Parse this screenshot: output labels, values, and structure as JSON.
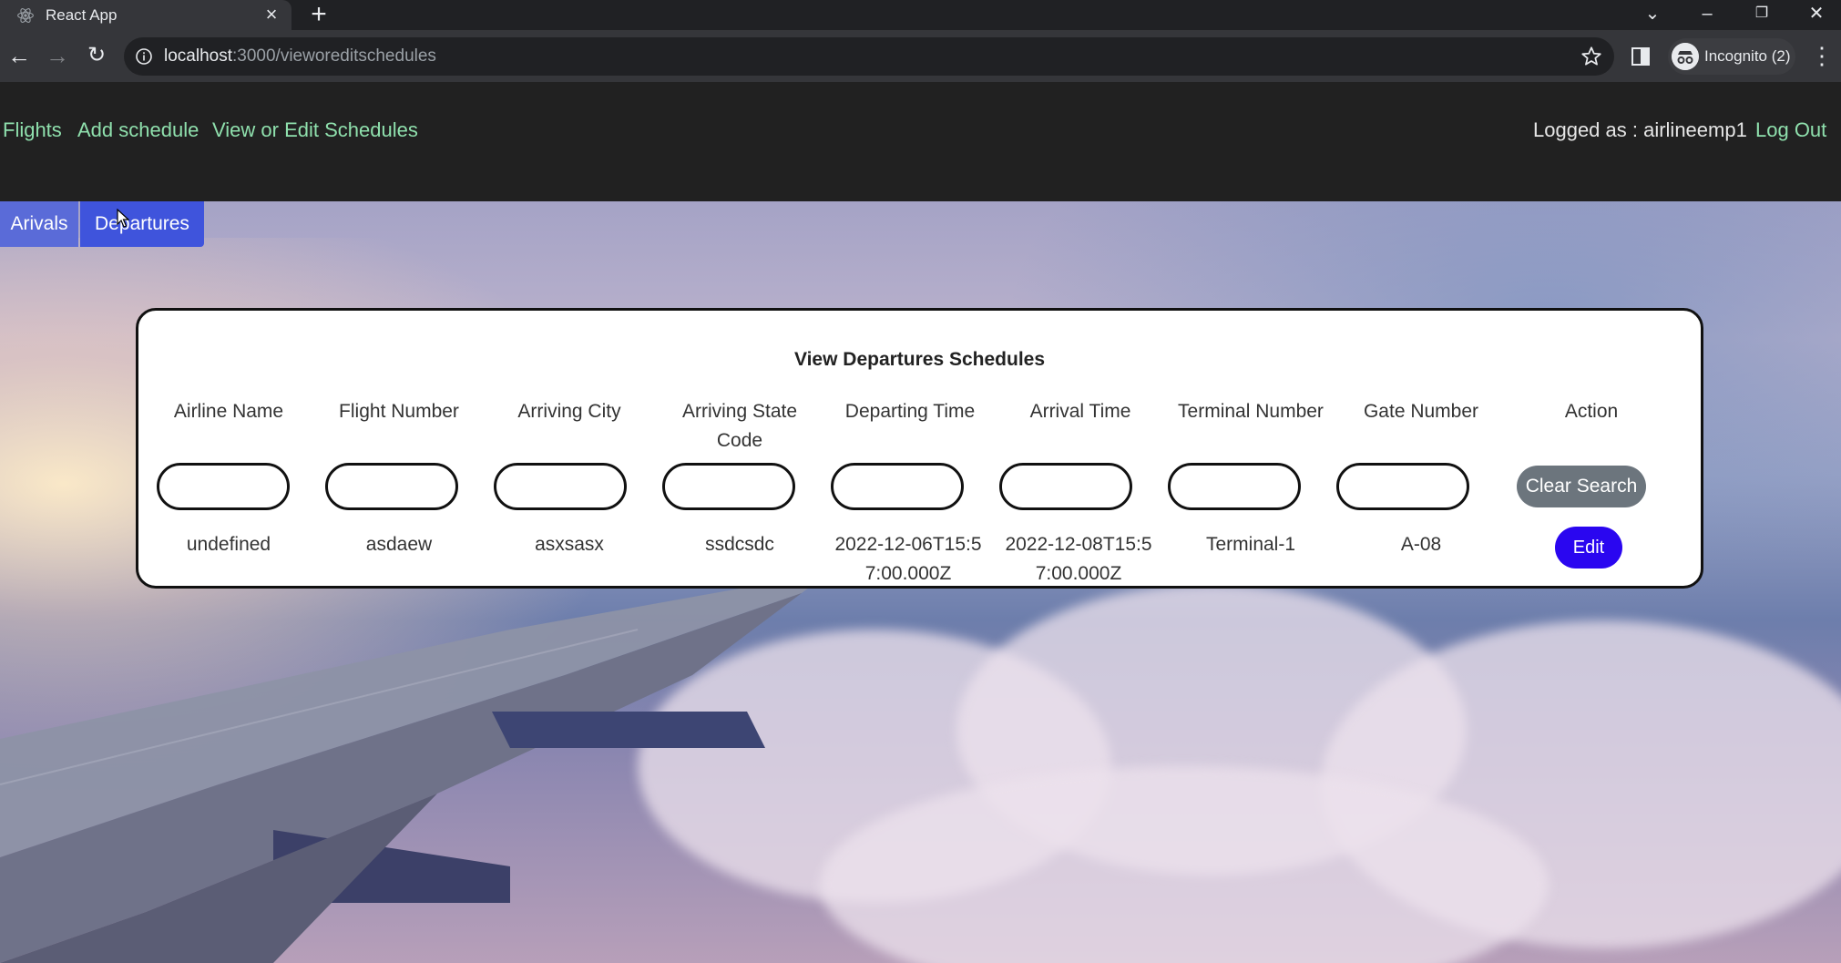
{
  "browser": {
    "tab_title": "React App",
    "url_host": "localhost",
    "url_rest": ":3000/vieworeditschedules",
    "profile_label": "Incognito (2)"
  },
  "nav": {
    "flights": "Flights",
    "add_schedule": "Add schedule",
    "view_edit": "View or Edit Schedules",
    "logged_as": "Logged as : airlineemp1",
    "logout": "Log Out"
  },
  "tabs": {
    "arrivals": "Arivals",
    "departures": "Departures"
  },
  "schedule": {
    "title": "View Departures Schedules",
    "columns": [
      "Airline Name",
      "Flight Number",
      "Arriving City",
      "Arriving State Code",
      "Departing Time",
      "Arrival Time",
      "Terminal Number",
      "Gate Number",
      "Action"
    ],
    "filters": [
      "",
      "",
      "",
      "",
      "",
      "",
      "",
      ""
    ],
    "clear_label": "Clear Search",
    "rows": [
      {
        "airline_name": "undefined",
        "flight_number": "asdaew",
        "arriving_city": "asxsasx",
        "arriving_state_code": "ssdcsdc",
        "departing_time": "2022-12-06T15:57:00.000Z",
        "arrival_time": "2022-12-08T15:57:00.000Z",
        "terminal_number": "Terminal-1",
        "gate_number": "A-08",
        "action_label": "Edit"
      }
    ]
  },
  "colors": {
    "nav_bg": "#212121",
    "nav_link": "#8fe0ad",
    "tab_active": "#3f54dc",
    "edit_button": "#2a06f0",
    "clear_button": "#6c757d"
  },
  "icons": [
    "react-logo-icon",
    "close-icon",
    "plus-icon",
    "back-icon",
    "forward-icon",
    "reload-icon",
    "info-icon",
    "star-icon",
    "side-panel-icon",
    "incognito-icon",
    "kebab-menu-icon",
    "chevron-down-icon",
    "minimize-icon",
    "restore-icon",
    "close-window-icon"
  ]
}
